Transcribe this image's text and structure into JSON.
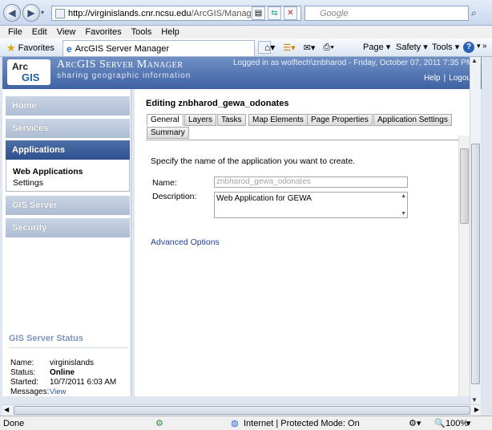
{
  "browser": {
    "url_host": "http://virginislands.cnr.ncsu.edu",
    "url_path": "/ArcGIS/Manager...",
    "search_placeholder": "Google",
    "menu": [
      "File",
      "Edit",
      "View",
      "Favorites",
      "Tools",
      "Help"
    ],
    "favorites_label": "Favorites",
    "tab_title": "ArcGIS Server Manager",
    "commands": {
      "page": "Page",
      "safety": "Safety",
      "tools": "Tools"
    }
  },
  "banner": {
    "logo_top": "Arc",
    "logo_bottom": "GIS",
    "title": "ArcGIS Server Manager",
    "tagline": "sharing geographic information",
    "logged_in": "Logged in as wolftech\\znbharod - Friday, October 07, 2011 7:35 PM",
    "help": "Help",
    "separator": "|",
    "logout": "Logout"
  },
  "sidebar": {
    "items": [
      {
        "label": "Home"
      },
      {
        "label": "Services"
      },
      {
        "label": "Applications"
      },
      {
        "label": "GIS Server"
      },
      {
        "label": "Security"
      }
    ],
    "sub": [
      "Web Applications",
      "Settings"
    ],
    "status_title": "GIS Server Status",
    "status": {
      "name_label": "Name:",
      "name": "virginislands",
      "status_label": "Status:",
      "status": "Online",
      "started_label": "Started:",
      "started": "10/7/2011 6:03 AM",
      "messages_label": "Messages:",
      "messages": "View"
    }
  },
  "main": {
    "heading": "Editing znbharod_gewa_odonates",
    "tabs": [
      "General",
      "Layers",
      "Tasks",
      "Map Elements",
      "Page Properties",
      "Application Settings",
      "Summary"
    ],
    "instruction": "Specify the name of the application you want to create.",
    "name_label": "Name:",
    "name_value": "znbharod_gewa_odonates",
    "desc_label": "Description:",
    "desc_value": "Web Application for GEWA",
    "advanced": "Advanced Options"
  },
  "status_bar": {
    "done": "Done",
    "zone": "Internet | Protected Mode: On",
    "zoom": "100%"
  }
}
